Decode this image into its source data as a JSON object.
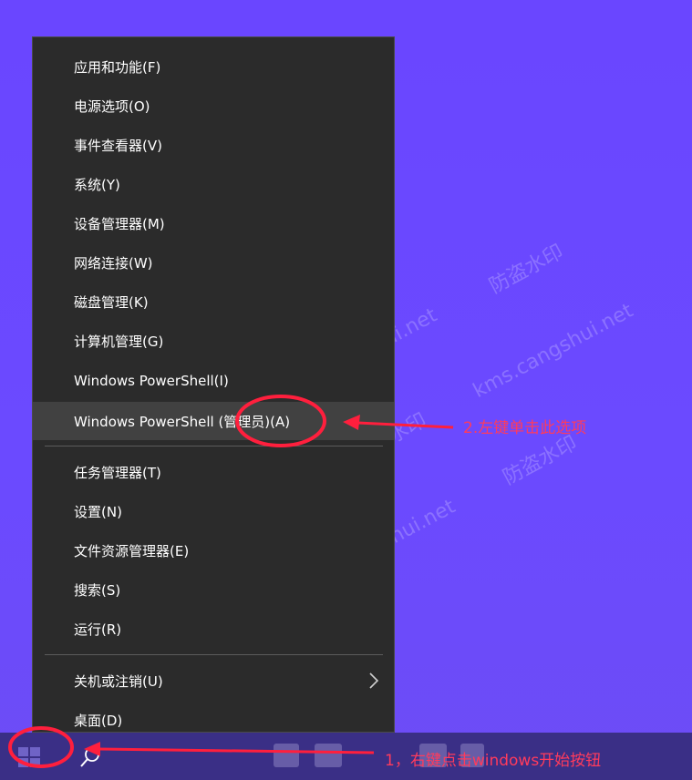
{
  "menu": {
    "items": [
      {
        "label": "应用和功能(F)"
      },
      {
        "label": "电源选项(O)"
      },
      {
        "label": "事件查看器(V)"
      },
      {
        "label": "系统(Y)"
      },
      {
        "label": "设备管理器(M)"
      },
      {
        "label": "网络连接(W)"
      },
      {
        "label": "磁盘管理(K)"
      },
      {
        "label": "计算机管理(G)"
      },
      {
        "label": "Windows PowerShell(I)"
      },
      {
        "label": "Windows PowerShell (管理员)(A)"
      },
      {
        "label": "任务管理器(T)"
      },
      {
        "label": "设置(N)"
      },
      {
        "label": "文件资源管理器(E)"
      },
      {
        "label": "搜索(S)"
      },
      {
        "label": "运行(R)"
      },
      {
        "label": "关机或注销(U)"
      },
      {
        "label": "桌面(D)"
      }
    ],
    "highlighted_index": 9
  },
  "annotations": {
    "step2": "2.左键单击此选项",
    "step1": "1，右键点击windows开始按钮"
  },
  "watermarks": {
    "cn": "防盗水印",
    "site": "kms.cangshui.net"
  },
  "colors": {
    "desktop": "#6b48ff",
    "menu_bg": "#2b2b2b",
    "highlight": "#414141",
    "annotation": "#ff3b5c",
    "taskbar": "#3a2f86"
  }
}
